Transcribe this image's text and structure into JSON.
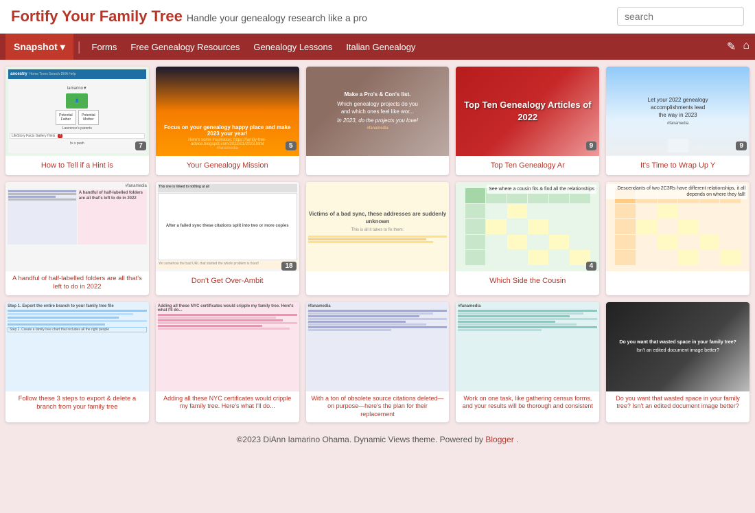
{
  "header": {
    "title_main": "Fortify Your Family Tree",
    "title_sub": "Handle your genealogy research like a pro",
    "search_placeholder": "search"
  },
  "navbar": {
    "snapshot_label": "Snapshot",
    "chevron": "▾",
    "items": [
      {
        "label": "Forms"
      },
      {
        "label": "Free Genealogy Resources"
      },
      {
        "label": "Genealogy Lessons"
      },
      {
        "label": "Italian Genealogy"
      }
    ],
    "edit_icon": "✎",
    "home_icon": "⌂"
  },
  "cards": [
    {
      "id": "card-1",
      "thumb_type": "ancestry",
      "title": "How to Tell if a Hint is",
      "badge": "7"
    },
    {
      "id": "card-2",
      "thumb_type": "sunset",
      "title": "Your Genealogy Mission",
      "badge": "5",
      "thumb_text": "Focus on your genealogy happy place and make 2023 your year!"
    },
    {
      "id": "card-3",
      "thumb_type": "coffee",
      "title": "",
      "badge": "",
      "thumb_text": "Make a Pro's & Con's list. Which genealogy projects do you and which ones feel like wor... In 2023, do the projects you love!"
    },
    {
      "id": "card-4",
      "thumb_type": "topten",
      "title": "Top Ten Genealogy Ar",
      "badge": "9",
      "thumb_text": "Top Ten Genealogy Articles of 2022"
    },
    {
      "id": "card-5",
      "thumb_type": "winter",
      "title": "It's Time to Wrap Up Y",
      "badge": "9",
      "thumb_text": "Let your 2022 genealogy accomplishments lead the way in 2023"
    },
    {
      "id": "card-6",
      "thumb_type": "folders",
      "title": "A handful of half-labelled folders are all that's left to do in 2022",
      "badge": "",
      "thumb_text": "A handful of half-labelled folders are all that's left to do in 2022"
    },
    {
      "id": "card-7",
      "thumb_type": "sync1",
      "title": "Don't Get Over-Ambit",
      "badge": "18",
      "thumb_text": "After a failed sync these citations split into two or more copies"
    },
    {
      "id": "card-8",
      "thumb_type": "sync2",
      "title": "",
      "badge": "",
      "thumb_text": "Victims of a bad sync, these addresses are suddenly unknown"
    },
    {
      "id": "card-9",
      "thumb_type": "cousin",
      "title": "Which Side the Cousin",
      "badge": "4",
      "thumb_text": "See where a cousin fits & find all the relationships"
    },
    {
      "id": "card-10",
      "thumb_type": "cousin2",
      "title": "",
      "badge": "",
      "thumb_text": "Descendants of two 2C3Rs have different relationships, it all depends on where they fall!"
    },
    {
      "id": "card-11",
      "thumb_type": "export",
      "title": "Follow these 3 steps to export & delete a branch from your family tree",
      "badge": "",
      "thumb_text": "Step 1. Export the entire branch to your family tree file"
    },
    {
      "id": "card-12",
      "thumb_type": "nyc",
      "title": "Adding all these NYC certificates would cripple my family tree. Here's what I'll do...",
      "badge": "",
      "thumb_text": "Adding all these NYC certificates would cripple my family tree."
    },
    {
      "id": "card-13",
      "thumb_type": "sources",
      "title": "With a ton of obsolete source citations deleted—on purpose—here's the plan for their replacement",
      "badge": "",
      "thumb_text": "With a ton of obsolete source citations deleted—on purpose—here's the plan for their replacement"
    },
    {
      "id": "card-14",
      "thumb_type": "census",
      "title": "Work on one task, like gathering census forms, and your results will be thorough and consistent",
      "badge": "",
      "thumb_text": "Work on one task, like gathering census forms, and your results will be thorough and consistent"
    },
    {
      "id": "card-15",
      "thumb_type": "document",
      "title": "Do you want that wasted space in your family tree? Isn't an edited document image better?",
      "badge": "",
      "thumb_text": "Do you want that wasted space in your family tree?"
    }
  ],
  "footer": {
    "text": "©2023 DiAnn Iamarino Ohama. Dynamic Views theme. Powered by",
    "link_text": "Blogger",
    "link_url": "#"
  }
}
